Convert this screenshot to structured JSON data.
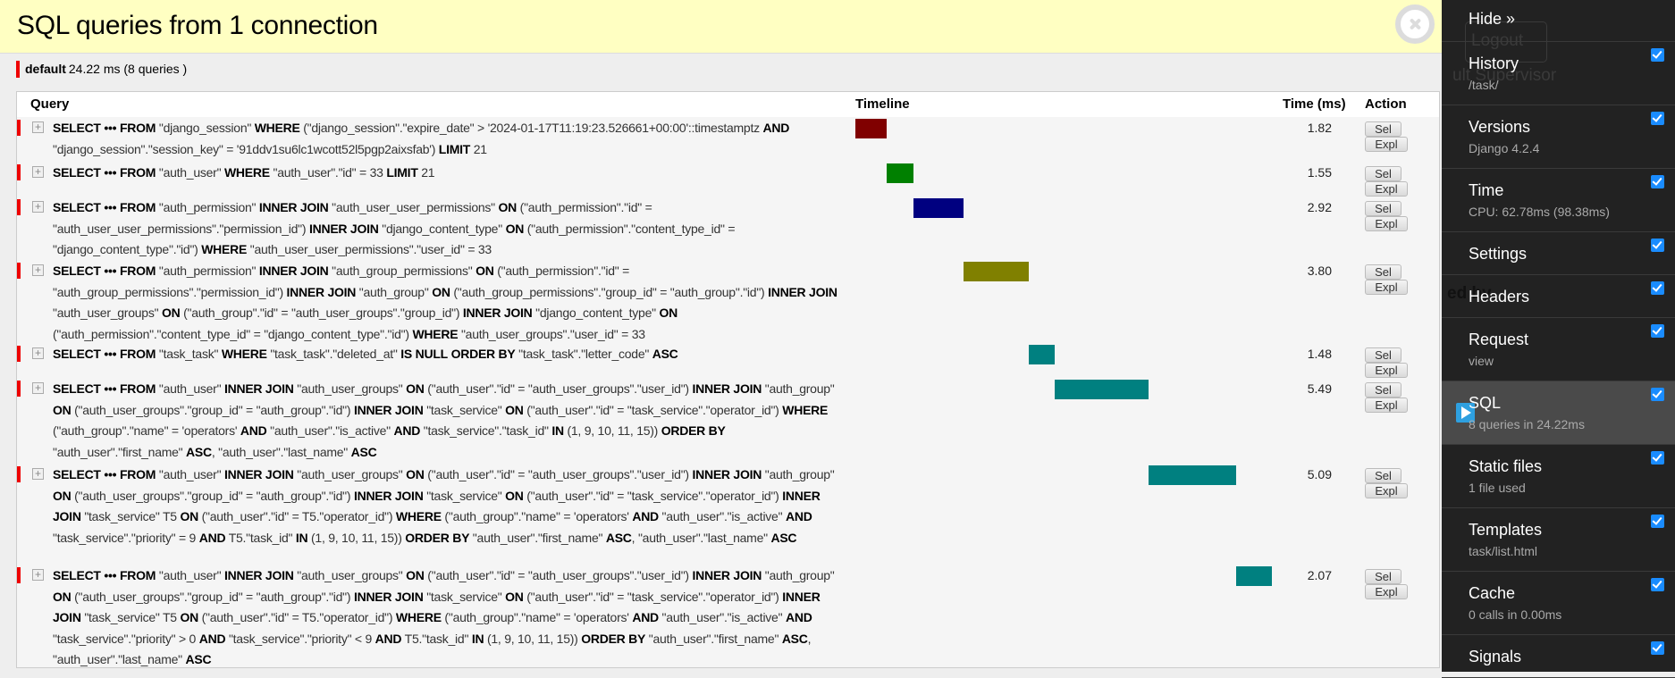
{
  "header": {
    "title": "SQL queries from 1 connection",
    "close_icon": "close-icon"
  },
  "connection": {
    "alias": "default",
    "summary": "24.22 ms (8 queries )",
    "color": "#ee0000"
  },
  "table": {
    "columns": {
      "query": "Query",
      "timeline": "Timeline",
      "time": "Time (ms)",
      "action": "Action"
    },
    "sel_label": "Sel",
    "expl_label": "Expl",
    "total_ms": 24.22,
    "rows": [
      {
        "sql": "SELECT ••• FROM \"django_session\" WHERE (\"django_session\".\"expire_date\" > '2024-01-17T11:19:23.526661+00:00'::timestamptz AND \"django_session\".\"session_key\" = '91ddv1su6lc1wcott52l5pgp2aixsfab') LIMIT 21",
        "time": "1.82",
        "color": "#800000"
      },
      {
        "sql": "SELECT ••• FROM \"auth_user\" WHERE \"auth_user\".\"id\" = 33 LIMIT 21",
        "time": "1.55",
        "color": "#008000"
      },
      {
        "sql": "SELECT ••• FROM \"auth_permission\" INNER JOIN \"auth_user_user_permissions\" ON (\"auth_permission\".\"id\" = \"auth_user_user_permissions\".\"permission_id\") INNER JOIN \"django_content_type\" ON (\"auth_permission\".\"content_type_id\" = \"django_content_type\".\"id\") WHERE \"auth_user_user_permissions\".\"user_id\" = 33",
        "time": "2.92",
        "color": "#000080"
      },
      {
        "sql": "SELECT ••• FROM \"auth_permission\" INNER JOIN \"auth_group_permissions\" ON (\"auth_permission\".\"id\" = \"auth_group_permissions\".\"permission_id\") INNER JOIN \"auth_group\" ON (\"auth_group_permissions\".\"group_id\" = \"auth_group\".\"id\") INNER JOIN \"auth_user_groups\" ON (\"auth_group\".\"id\" = \"auth_user_groups\".\"group_id\") INNER JOIN \"django_content_type\" ON (\"auth_permission\".\"content_type_id\" = \"django_content_type\".\"id\") WHERE \"auth_user_groups\".\"user_id\" = 33",
        "time": "3.80",
        "color": "#808000"
      },
      {
        "sql": "SELECT ••• FROM \"task_task\" WHERE \"task_task\".\"deleted_at\" IS NULL ORDER BY \"task_task\".\"letter_code\" ASC",
        "time": "1.48",
        "color": "#008080"
      },
      {
        "sql": "SELECT ••• FROM \"auth_user\" INNER JOIN \"auth_user_groups\" ON (\"auth_user\".\"id\" = \"auth_user_groups\".\"user_id\") INNER JOIN \"auth_group\" ON (\"auth_user_groups\".\"group_id\" = \"auth_group\".\"id\") INNER JOIN \"task_service\" ON (\"auth_user\".\"id\" = \"task_service\".\"operator_id\") WHERE (\"auth_group\".\"name\" = 'operators' AND \"auth_user\".\"is_active\" AND \"task_service\".\"task_id\" IN (1, 9, 10, 11, 15)) ORDER BY \"auth_user\".\"first_name\" ASC, \"auth_user\".\"last_name\" ASC",
        "time": "5.49",
        "color": "#008080"
      },
      {
        "sql": "SELECT ••• FROM \"auth_user\" INNER JOIN \"auth_user_groups\" ON (\"auth_user\".\"id\" = \"auth_user_groups\".\"user_id\") INNER JOIN \"auth_group\" ON (\"auth_user_groups\".\"group_id\" = \"auth_group\".\"id\") INNER JOIN \"task_service\" ON (\"auth_user\".\"id\" = \"task_service\".\"operator_id\") INNER JOIN \"task_service\" T5 ON (\"auth_user\".\"id\" = T5.\"operator_id\") WHERE (\"auth_group\".\"name\" = 'operators' AND \"auth_user\".\"is_active\" AND \"task_service\".\"priority\" = 9 AND T5.\"task_id\" IN (1, 9, 10, 11, 15)) ORDER BY \"auth_user\".\"first_name\" ASC, \"auth_user\".\"last_name\" ASC",
        "time": "5.09",
        "color": "#008080"
      },
      {
        "sql": "SELECT ••• FROM \"auth_user\" INNER JOIN \"auth_user_groups\" ON (\"auth_user\".\"id\" = \"auth_user_groups\".\"user_id\") INNER JOIN \"auth_group\" ON (\"auth_user_groups\".\"group_id\" = \"auth_group\".\"id\") INNER JOIN \"task_service\" ON (\"auth_user\".\"id\" = \"task_service\".\"operator_id\") INNER JOIN \"task_service\" T5 ON (\"auth_user\".\"id\" = T5.\"operator_id\") WHERE (\"auth_group\".\"name\" = 'operators' AND \"auth_user\".\"is_active\" AND \"task_service\".\"priority\" > 0 AND \"task_service\".\"priority\" < 9 AND T5.\"task_id\" IN (1, 9, 10, 11, 15)) ORDER BY \"auth_user\".\"first_name\" ASC, \"auth_user\".\"last_name\" ASC",
        "time": "2.07",
        "color": "#008080"
      }
    ]
  },
  "toolbar": {
    "hide_label": "Hide »",
    "panels": [
      {
        "title": "History",
        "subtitle": "/task/",
        "checked": true
      },
      {
        "title": "Versions",
        "subtitle": "Django 4.2.4",
        "checked": true
      },
      {
        "title": "Time",
        "subtitle": "CPU: 62.78ms (98.38ms)",
        "checked": true
      },
      {
        "title": "Settings",
        "subtitle": "",
        "checked": true
      },
      {
        "title": "Headers",
        "subtitle": "",
        "checked": true
      },
      {
        "title": "Request",
        "subtitle": "view",
        "checked": true
      },
      {
        "title": "SQL",
        "subtitle": "8 queries in 24.22ms",
        "checked": true,
        "active": true
      },
      {
        "title": "Static files",
        "subtitle": "1 file used",
        "checked": true
      },
      {
        "title": "Templates",
        "subtitle": "task/list.html",
        "checked": true
      },
      {
        "title": "Cache",
        "subtitle": "0 calls in 0.00ms",
        "checked": true
      },
      {
        "title": "Signals",
        "subtitle": "",
        "checked": true
      }
    ],
    "accent": "#2ea0e0"
  },
  "background_page": {
    "logout": "Logout",
    "user_fragment": "ult Supervisor",
    "heading_fragment": "ed by"
  }
}
